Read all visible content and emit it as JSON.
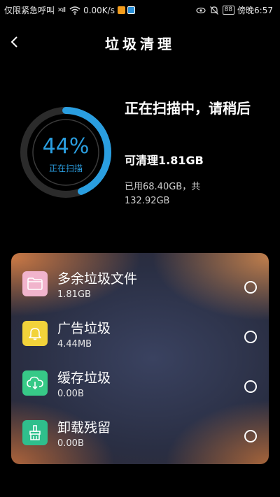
{
  "status_bar": {
    "carrier_text": "仅限紧急呼叫",
    "signal": "✕ıll",
    "network_speed": "0.00K/s",
    "battery_level": "88",
    "time": "傍晚6:57"
  },
  "header": {
    "title": "垃圾清理"
  },
  "scan": {
    "progress_percent": 44,
    "percent_label": "44%",
    "status_label": "正在扫描",
    "title": "正在扫描中，请稍后",
    "cleanable": "可清理1.81GB",
    "usage": "已用68.40GB，共132.92GB"
  },
  "colors": {
    "accent": "#2a9ee0",
    "ring_track": "#2b2b2b",
    "icon_pink": "#f1b4cc",
    "icon_yellow": "#f2d33a",
    "icon_green": "#37c987",
    "icon_teal": "#2fbf8c"
  },
  "junk_items": [
    {
      "name": "多余垃圾文件",
      "size": "1.81GB",
      "icon": "folder-icon"
    },
    {
      "name": "广告垃圾",
      "size": "4.44MB",
      "icon": "bell-icon"
    },
    {
      "name": "缓存垃圾",
      "size": "0.00B",
      "icon": "cloud-download-icon"
    },
    {
      "name": "卸载残留",
      "size": "0.00B",
      "icon": "brush-icon"
    }
  ]
}
